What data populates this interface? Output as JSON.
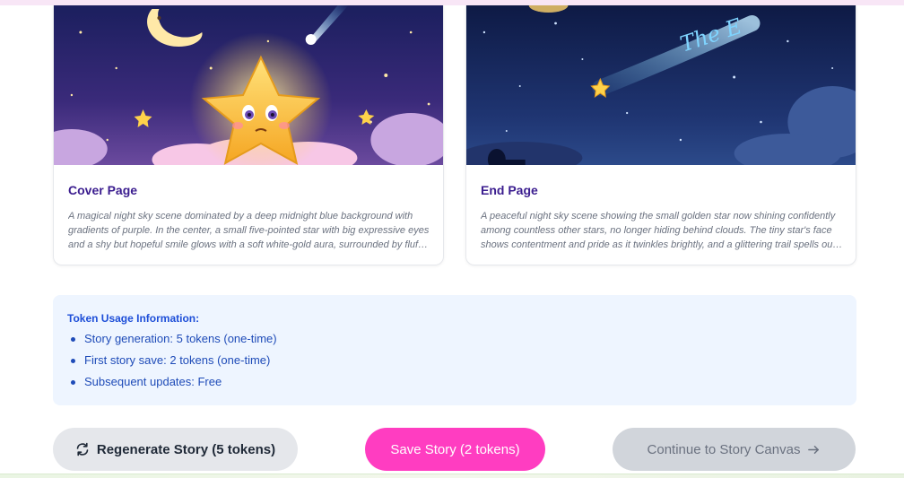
{
  "cards": [
    {
      "title": "Cover Page",
      "description": "A magical night sky scene dominated by a deep midnight blue background with gradients of purple. In the center, a small five-pointed star with big expressive eyes and a shy but hopeful smile glows with a soft white-gold aura, surrounded by fluffy pink clouds and twinkling stars.",
      "image_icon": "smiling-star-illustration"
    },
    {
      "title": "End Page",
      "description": "A peaceful night sky scene showing the small golden star now shining confidently among countless other stars, no longer hiding behind clouds. The tiny star's face shows contentment and pride as it twinkles brightly, and a glittering trail spells out the ending.",
      "image_icon": "night-sky-end-illustration",
      "sky_text": "The E"
    }
  ],
  "token_info": {
    "title": "Token Usage Information:",
    "items": [
      "Story generation: 5 tokens (one-time)",
      "First story save: 2 tokens (one-time)",
      "Subsequent updates: Free"
    ]
  },
  "buttons": {
    "regenerate": "Regenerate Story (5 tokens)",
    "save": "Save Story (2 tokens)",
    "continue": "Continue to Story Canvas"
  },
  "colors": {
    "accent_pink": "#ff3dc1",
    "title_purple": "#3b1d8f",
    "info_blue": "#1d4ed8",
    "info_bg": "#eef5ff"
  }
}
